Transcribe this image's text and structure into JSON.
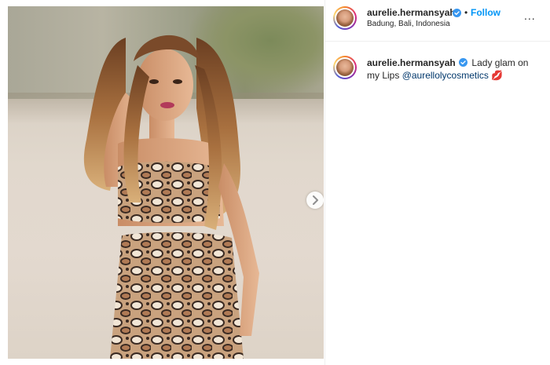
{
  "header": {
    "username": "aurelie.hermansyah",
    "separator": "•",
    "follow_label": "Follow",
    "location": "Badung, Bali, Indonesia",
    "more_label": "..."
  },
  "caption": {
    "username": "aurelie.hermansyah",
    "text_line1": "Lady glam on",
    "text_line2": "my Lips",
    "mention": "@aurellolycosmetics",
    "emoji": "💋"
  },
  "icons": {
    "verified": "verified-badge-icon",
    "next": "chevron-right-icon",
    "more": "more-options-icon"
  },
  "colors": {
    "follow": "#0095f6",
    "mention": "#00376b",
    "verified": "#3897f0"
  }
}
